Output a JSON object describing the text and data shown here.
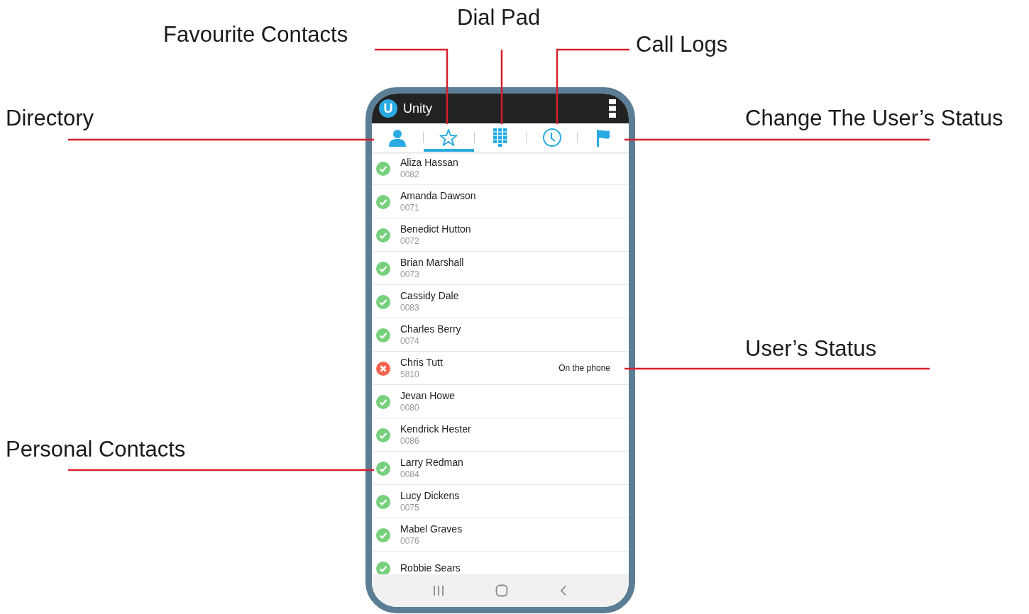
{
  "annotations": [
    {
      "label": "Favourite Contacts"
    },
    {
      "label": "Dial Pad"
    },
    {
      "label": "Call Logs"
    },
    {
      "label": "Directory"
    },
    {
      "label": "Change The User’s Status"
    },
    {
      "label": "User’s Status"
    },
    {
      "label": "Personal Contacts"
    }
  ],
  "app": {
    "title": "Unity",
    "logo": "U"
  },
  "tabs": [
    {
      "kind": "directory",
      "selected": false
    },
    {
      "kind": "favourites",
      "selected": true
    },
    {
      "kind": "dialpad",
      "selected": false
    },
    {
      "kind": "logs",
      "selected": false
    },
    {
      "kind": "status",
      "selected": false
    }
  ],
  "contacts": [
    {
      "name": "Aliza Hassan",
      "number": "0082",
      "kind": "available"
    },
    {
      "name": "Amanda Dawson",
      "number": "0071",
      "kind": "available"
    },
    {
      "name": "Benedict Hutton",
      "number": "0072",
      "kind": "available"
    },
    {
      "name": "Brian Marshall",
      "number": "0073",
      "kind": "available"
    },
    {
      "name": "Cassidy Dale",
      "number": "0083",
      "kind": "available"
    },
    {
      "name": "Charles Berry",
      "number": "0074",
      "kind": "available"
    },
    {
      "name": "Chris Tutt",
      "number": "5810",
      "kind": "busy",
      "status_text": "On the phone"
    },
    {
      "name": "Jevan Howe",
      "number": "0080",
      "kind": "available"
    },
    {
      "name": "Kendrick Hester",
      "number": "0086",
      "kind": "available"
    },
    {
      "name": "Larry Redman",
      "number": "0084",
      "kind": "available"
    },
    {
      "name": "Lucy Dickens",
      "number": "0075",
      "kind": "available"
    },
    {
      "name": "Mabel Graves",
      "number": "0076",
      "kind": "available"
    },
    {
      "name": "Robbie Sears",
      "kind": "available"
    }
  ]
}
